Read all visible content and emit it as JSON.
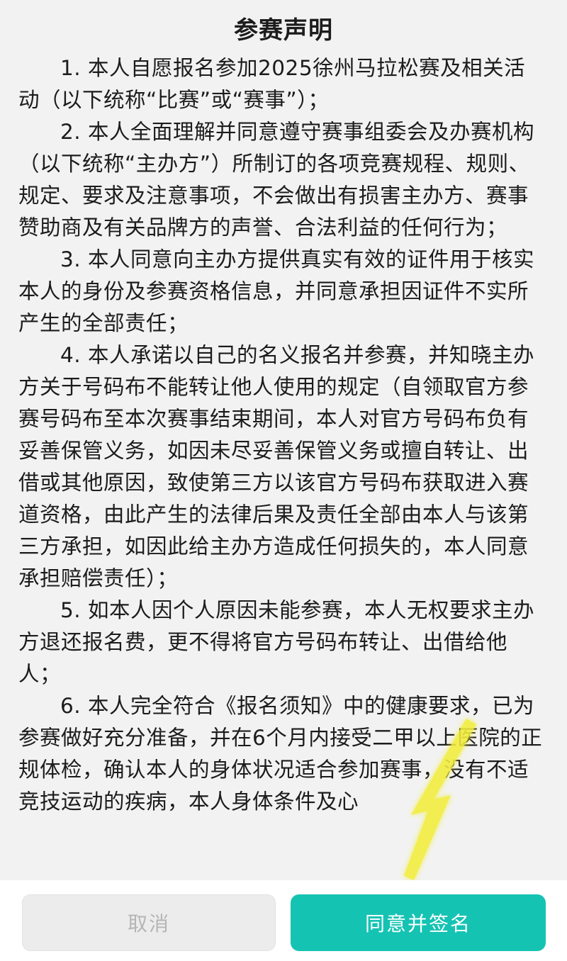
{
  "title": "参赛声明",
  "paragraphs": [
    "1. 本人自愿报名参加2025徐州马拉松赛及相关活动（以下统称“比赛”或“赛事”）；",
    "2. 本人全面理解并同意遵守赛事组委会及办赛机构（以下统称“主办方”）所制订的各项竞赛规程、规则、规定、要求及注意事项，不会做出有损害主办方、赛事赞助商及有关品牌方的声誉、合法利益的任何行为；",
    "3. 本人同意向主办方提供真实有效的证件用于核实本人的身份及参赛资格信息，并同意承担因证件不实所产生的全部责任；",
    "4. 本人承诺以自己的名义报名并参赛，并知晓主办方关于号码布不能转让他人使用的规定（自领取官方参赛号码布至本次赛事结束期间，本人对官方号码布负有妥善保管义务，如因未尽妥善保管义务或擅自转让、出借或其他原因，致使第三方以该官方号码布获取进入赛道资格，由此产生的法律后果及责任全部由本人与该第三方承担，如因此给主办方造成任何损失的，本人同意承担赔偿责任）；",
    "5. 如本人因个人原因未能参赛，本人无权要求主办方退还报名费，更不得将官方号码布转让、出借给他人；",
    "6. 本人完全符合《报名须知》中的健康要求，已为参赛做好充分准备，并在6个月内接受二甲以上医院的正规体检，确认本人的身体状况适合参加赛事，没有不适竞技运动的疾病，本人身体条件及心"
  ],
  "buttons": {
    "cancel": "取消",
    "agree": "同意并签名"
  },
  "colors": {
    "accent": "#15c3b3",
    "annotation_arrow": "#f3ee3a"
  },
  "icons": {
    "annotation": "yellow-arrow-icon"
  }
}
